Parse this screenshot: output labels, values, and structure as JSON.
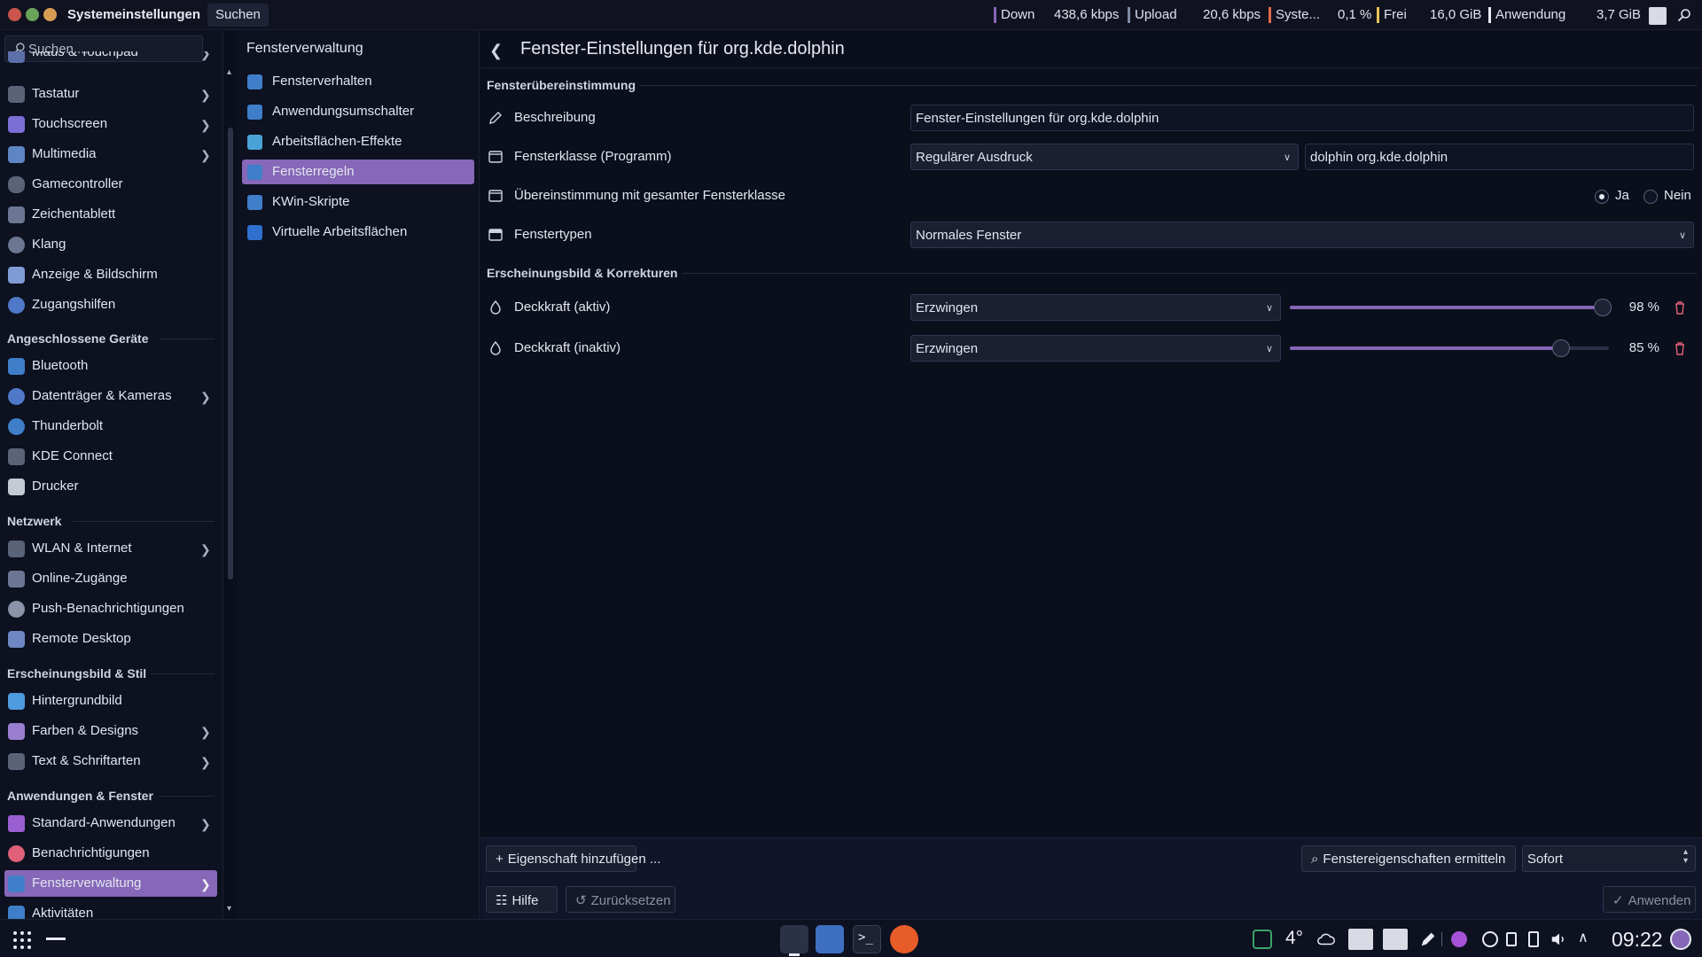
{
  "topbar": {
    "app_title": "Systemeinstellungen",
    "menu_search": "Suchen",
    "monitors": [
      {
        "label": "Down",
        "value": "438,6 kbps",
        "color": "#8667b8"
      },
      {
        "label": "Upload",
        "value": "20,6 kbps",
        "color": "#7f8aa3"
      },
      {
        "label": "Syste...",
        "value": "0,1 %",
        "color": "#e06a4f"
      },
      {
        "label": "Frei",
        "value": "16,0 GiB",
        "color": "#e8c35a"
      },
      {
        "label": "Anwendung",
        "value": "3,7 GiB",
        "color": "#e8ebf3"
      }
    ]
  },
  "sidebar": {
    "search_placeholder": "Suchen ...",
    "partial_top": "Maus & Touchpad",
    "items": [
      {
        "label": "Tastatur",
        "chevron": true
      },
      {
        "label": "Touchscreen",
        "chevron": true
      },
      {
        "label": "Multimedia",
        "chevron": true
      },
      {
        "label": "Gamecontroller",
        "chevron": false
      },
      {
        "label": "Zeichentablett",
        "chevron": false
      },
      {
        "label": "Klang",
        "chevron": false
      },
      {
        "label": "Anzeige & Bildschirm",
        "chevron": false
      },
      {
        "label": "Zugangshilfen",
        "chevron": false
      }
    ],
    "section_devices": "Angeschlossene Geräte",
    "devices": [
      {
        "label": "Bluetooth",
        "chevron": false
      },
      {
        "label": "Datenträger & Kameras",
        "chevron": true
      },
      {
        "label": "Thunderbolt",
        "chevron": false
      },
      {
        "label": "KDE Connect",
        "chevron": false
      },
      {
        "label": "Drucker",
        "chevron": false
      }
    ],
    "section_network": "Netzwerk",
    "network": [
      {
        "label": "WLAN & Internet",
        "chevron": true
      },
      {
        "label": "Online-Zugänge",
        "chevron": false
      },
      {
        "label": "Push-Benachrichtigungen",
        "chevron": false
      },
      {
        "label": "Remote Desktop",
        "chevron": false
      }
    ],
    "section_appearance": "Erscheinungsbild & Stil",
    "appearance": [
      {
        "label": "Hintergrundbild",
        "chevron": false
      },
      {
        "label": "Farben & Designs",
        "chevron": true
      },
      {
        "label": "Text & Schriftarten",
        "chevron": true
      }
    ],
    "section_apps": "Anwendungen & Fenster",
    "apps": [
      {
        "label": "Standard-Anwendungen",
        "chevron": true
      },
      {
        "label": "Benachrichtigungen",
        "chevron": false
      },
      {
        "label": "Fensterverwaltung",
        "chevron": true,
        "active": true
      },
      {
        "label": "Aktivitäten",
        "chevron": false
      }
    ]
  },
  "midpanel": {
    "title": "Fensterverwaltung",
    "items": [
      {
        "label": "Fensterverhalten"
      },
      {
        "label": "Anwendungsumschalter"
      },
      {
        "label": "Arbeitsflächen-Effekte"
      },
      {
        "label": "Fensterregeln",
        "active": true
      },
      {
        "label": "KWin-Skripte"
      },
      {
        "label": "Virtuelle Arbeitsflächen"
      }
    ]
  },
  "main": {
    "title": "Fenster-Einstellungen für org.kde.dolphin",
    "section_match": "Fensterübereinstimmung",
    "description": {
      "label": "Beschreibung",
      "value": "Fenster-Einstellungen für org.kde.dolphin"
    },
    "window_class": {
      "label": "Fensterklasse (Programm)",
      "mode": "Regulärer Ausdruck",
      "value": "dolphin org.kde.dolphin"
    },
    "whole_class": {
      "label": "Übereinstimmung mit gesamter Fensterklasse",
      "yes": "Ja",
      "no": "Nein",
      "selected": "Ja"
    },
    "window_types": {
      "label": "Fenstertypen",
      "value": "Normales Fenster"
    },
    "section_appearance": "Erscheinungsbild & Korrekturen",
    "opacity_active": {
      "label": "Deckkraft (aktiv)",
      "policy": "Erzwingen",
      "value": 98,
      "value_text": "98 %"
    },
    "opacity_inactive": {
      "label": "Deckkraft (inaktiv)",
      "policy": "Erzwingen",
      "value": 85,
      "value_text": "85 %"
    },
    "add_property": "Eigenschaft hinzufügen ...",
    "detect_properties": "Fenstereigenschaften ermitteln",
    "detect_delay": "Sofort",
    "help": "Hilfe",
    "reset": "Zurücksetzen",
    "apply": "Anwenden"
  },
  "taskbar": {
    "temperature": "4°",
    "clock": "09:22"
  },
  "colors": {
    "accent": "#8667b8",
    "background": "#0b0f1c"
  }
}
